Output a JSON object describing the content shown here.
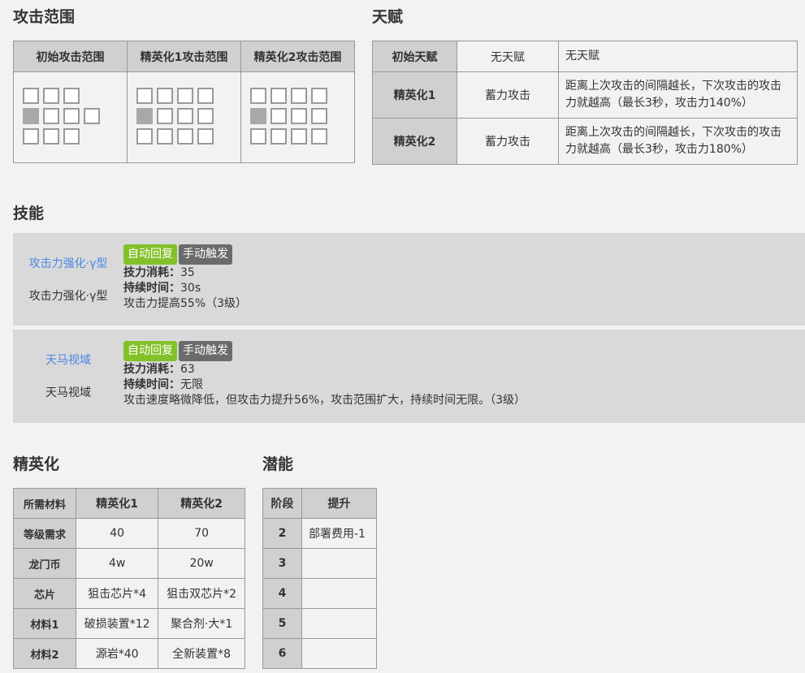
{
  "sections": {
    "range": "攻击范围",
    "talent": "天赋",
    "skills": "技能",
    "elite": "精英化",
    "potential": "潜能"
  },
  "range": {
    "headers": [
      "初始攻击范围",
      "精英化1攻击范围",
      "精英化2攻击范围"
    ]
  },
  "talent": {
    "rows": [
      {
        "phase": "初始天赋",
        "name": "无天赋",
        "desc": "无天赋"
      },
      {
        "phase": "精英化1",
        "name": "蓄力攻击",
        "desc": "距离上次攻击的间隔越长，下次攻击的攻击力就越高（最长3秒，攻击力140%）"
      },
      {
        "phase": "精英化2",
        "name": "蓄力攻击",
        "desc": "距离上次攻击的间隔越长，下次攻击的攻击力就越高（最长3秒，攻击力180%）"
      }
    ]
  },
  "skills": [
    {
      "link": "攻击力强化·γ型",
      "name": "攻击力强化·γ型",
      "tag_recovery": "自动回复",
      "tag_trigger": "手动触发",
      "cost_label": "技力消耗：",
      "cost": "35",
      "duration_label": "持续时间：",
      "duration": "30s",
      "desc": "攻击力提高55%（3级）"
    },
    {
      "link": "天马视域",
      "name": "天马视域",
      "tag_recovery": "自动回复",
      "tag_trigger": "手动触发",
      "cost_label": "技力消耗：",
      "cost": "63",
      "duration_label": "持续时间：",
      "duration": "无限",
      "desc": "攻击速度略微降低，但攻击力提升56%，攻击范围扩大，持续时间无限。（3级）"
    }
  ],
  "elite": {
    "headers": [
      "所需材料",
      "精英化1",
      "精英化2"
    ],
    "rows": [
      {
        "label": "等级需求",
        "e1": "40",
        "e2": "70"
      },
      {
        "label": "龙门币",
        "e1": "4w",
        "e2": "20w"
      },
      {
        "label": "芯片",
        "e1": "狙击芯片*4",
        "e2": "狙击双芯片*2"
      },
      {
        "label": "材料1",
        "e1": "破损装置*12",
        "e2": "聚合剂·大*1"
      },
      {
        "label": "材料2",
        "e1": "源岩*40",
        "e2": "全新装置*8"
      }
    ]
  },
  "potential": {
    "headers": [
      "阶段",
      "提升"
    ],
    "rows": [
      {
        "stage": "2",
        "value": "部署费用-1"
      },
      {
        "stage": "3",
        "value": ""
      },
      {
        "stage": "4",
        "value": ""
      },
      {
        "stage": "5",
        "value": ""
      },
      {
        "stage": "6",
        "value": ""
      }
    ]
  },
  "colors": {
    "link": "#4a86e8",
    "tag_recovery": "#83c12a",
    "tag_trigger": "#6b6b6b",
    "header_bg": "#d0d0d0",
    "operator_cell": "#a8a8a8"
  }
}
